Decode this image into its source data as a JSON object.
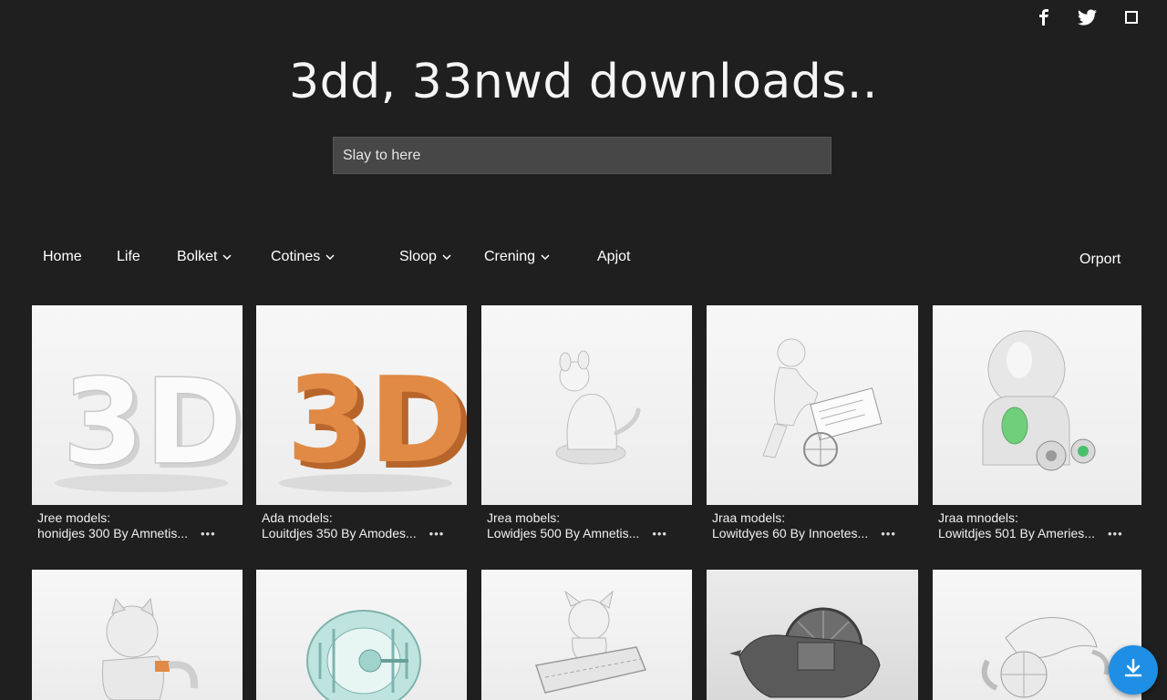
{
  "social": [
    {
      "name": "facebook-icon",
      "glyph": "f"
    },
    {
      "name": "twitter-icon"
    },
    {
      "name": "share-square-icon"
    }
  ],
  "title": "3dd, 33nwd downloads..",
  "search": {
    "placeholder": "Slay to here"
  },
  "nav": {
    "items": [
      {
        "label": "Home",
        "dropdown": false
      },
      {
        "label": "Life",
        "dropdown": false
      },
      {
        "label": "Bolket",
        "dropdown": true
      },
      {
        "label": "Cotines",
        "dropdown": true
      },
      {
        "label": "Sloop",
        "dropdown": true
      },
      {
        "label": "Crening",
        "dropdown": true
      },
      {
        "label": "Apjot",
        "dropdown": false
      }
    ],
    "right_label": "Orport"
  },
  "cards": [
    {
      "title": "Jree models:",
      "sub": "honidjes 300 By Amnetis...",
      "image": "3d-white-letters"
    },
    {
      "title": "Ada models:",
      "sub": "Louitdjes 350 By Amodes...",
      "image": "3d-orange-letters"
    },
    {
      "title": "Jrea mobels:",
      "sub": "Lowidjes 500 By Amnetis...",
      "image": "dog-figurine"
    },
    {
      "title": "Jraa models:",
      "sub": "Lowitdyes 60 By Innoetes...",
      "image": "figure-pushing-cart"
    },
    {
      "title": "Jraa mnodels:",
      "sub": "Lowitdjes 501 By Ameries...",
      "image": "robot-bulb-vehicle"
    }
  ],
  "cards_row2": [
    {
      "image": "cat-figurine"
    },
    {
      "image": "mint-wheel"
    },
    {
      "image": "cat-on-tank"
    },
    {
      "image": "boar-with-wheel"
    },
    {
      "image": "dolphin-creature"
    }
  ],
  "more_label": "•••",
  "colors": {
    "background": "#1f1f1f",
    "search_bg": "#474747",
    "fab": "#1e8fe4",
    "orange_model": "#e08a45"
  }
}
